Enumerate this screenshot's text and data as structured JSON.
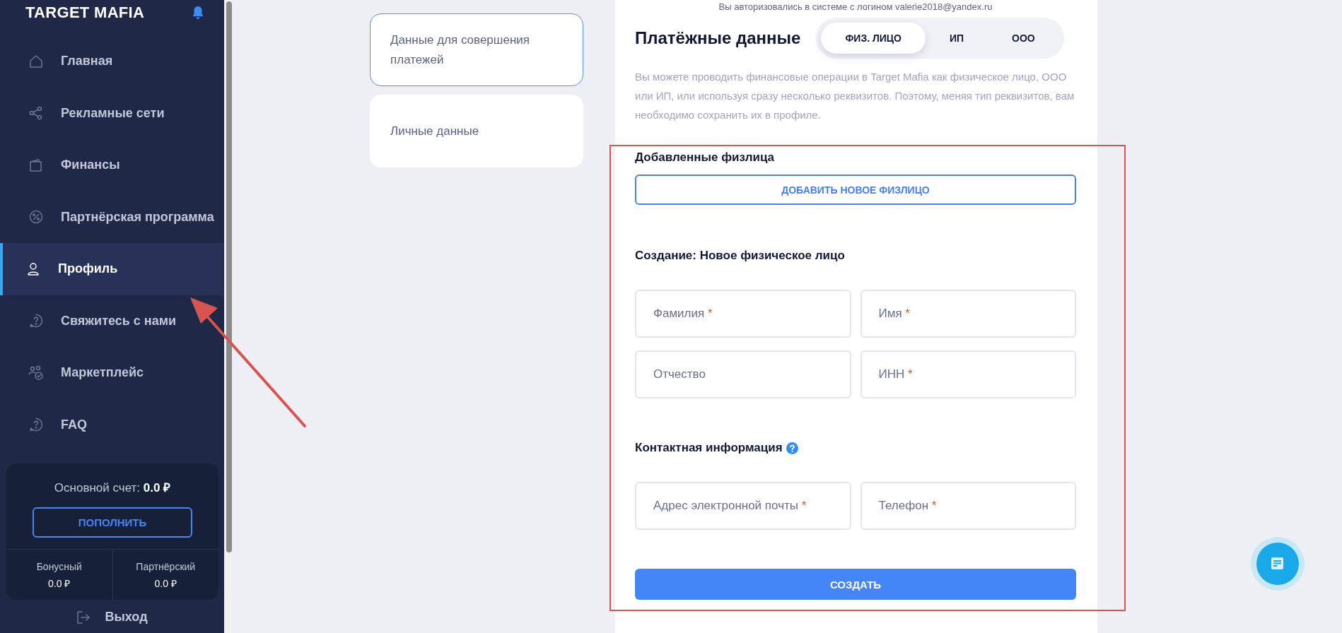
{
  "sidebar": {
    "logo": "TARGET MAFIA",
    "items": [
      {
        "label": "Главная",
        "selected": false
      },
      {
        "label": "Рекламные сети",
        "selected": false
      },
      {
        "label": "Финансы",
        "selected": false
      },
      {
        "label": "Партнёрская программа",
        "selected": false
      },
      {
        "label": "Профиль",
        "selected": true
      },
      {
        "label": "Свяжитесь с нами",
        "selected": false
      },
      {
        "label": "Маркетплейс",
        "selected": false
      },
      {
        "label": "FAQ",
        "selected": false
      }
    ],
    "balance": {
      "label": "Основной счет:",
      "amount": "0.0 ₽",
      "button": "ПОПОЛНИТЬ",
      "accounts": [
        {
          "label": "Бонусный",
          "amount": "0.0 ₽"
        },
        {
          "label": "Партнёрский",
          "amount": "0.0 ₽"
        }
      ]
    },
    "logout": "Выход"
  },
  "sections": [
    {
      "label": "Данные для совершения платежей",
      "selected": true
    },
    {
      "label": "Личные данные",
      "selected": false
    }
  ],
  "login_note": "Вы авторизовались в системе с логином valerie2018@yandex.ru",
  "payment": {
    "title": "Платёжные данные",
    "types": [
      {
        "label": "ФИЗ. ЛИЦО",
        "selected": true
      },
      {
        "label": "ИП",
        "selected": false
      },
      {
        "label": "ООО",
        "selected": false
      }
    ],
    "description": "Вы можете проводить финансовые операции в Target Mafia как физическое лицо, ООО или ИП, или используя сразу несколько реквизитов. Поэтому, меняя тип реквизитов, вам необходимо сохранить их в профиле."
  },
  "required_mark": "*",
  "added": {
    "title": "Добавленные физлица",
    "button": "ДОБАВИТЬ НОВОЕ ФИЗЛИЦО"
  },
  "create": {
    "title": "Создание: Новое физическое лицо",
    "fields": [
      {
        "placeholder": "Фамилия",
        "required": true
      },
      {
        "placeholder": "Имя",
        "required": true
      },
      {
        "placeholder": "Отчество",
        "required": false
      },
      {
        "placeholder": "ИНН",
        "required": true
      }
    ]
  },
  "contact": {
    "title": "Контактная информация",
    "fields": [
      {
        "placeholder": "Адрес электронной почты",
        "required": true
      },
      {
        "placeholder": "Телефон",
        "required": true
      }
    ]
  },
  "submit": "СОЗДАТЬ"
}
